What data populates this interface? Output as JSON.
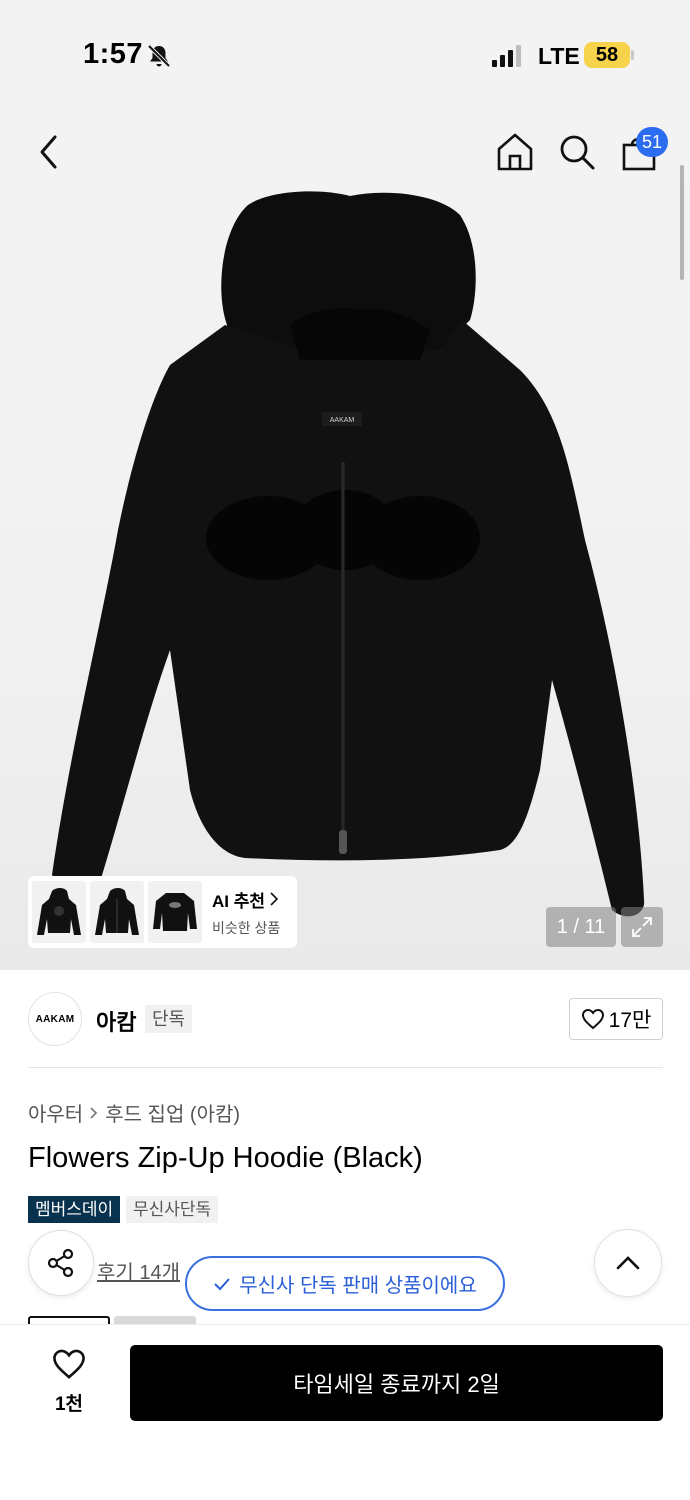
{
  "status_bar": {
    "time": "1:57",
    "network": "LTE",
    "battery": "58"
  },
  "header": {
    "cart_count": "51"
  },
  "gallery": {
    "counter": "1 / 11",
    "ai_title": "AI 추천",
    "ai_subtitle": "비슷한 상품",
    "hoodie_label": "AAKAM"
  },
  "brand": {
    "logo_text": "AAKAM",
    "name": "아캄",
    "tag": "단독",
    "likes": "17만"
  },
  "product": {
    "breadcrumb": [
      "아우터",
      "후드 집업 (아캄)"
    ],
    "title": "Flowers Zip-Up Hoodie (Black)",
    "tags": [
      "멤버스데이",
      "무신사단독"
    ],
    "review_link": "후기 14개"
  },
  "toast": {
    "message": "무신사 단독 판매 상품이에요"
  },
  "bottom": {
    "wish_count": "1천",
    "buy_label": "타임세일 종료까지 2일"
  },
  "colors": {
    "accent_blue": "#2b6cf0",
    "tag_navy": "#08324e",
    "battery_yellow": "#f6d34a"
  }
}
